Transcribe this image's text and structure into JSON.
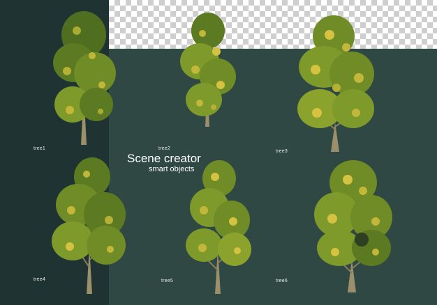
{
  "heading": {
    "title": "Scene creator",
    "subtitle": "smart objects"
  },
  "trees": [
    {
      "label": "tree1"
    },
    {
      "label": "tree2"
    },
    {
      "label": "tree3"
    },
    {
      "label": "tree4"
    },
    {
      "label": "tree5"
    },
    {
      "label": "tree6"
    }
  ],
  "colors": {
    "background": "#2f4843",
    "left_panel": "#1f3432",
    "foliage_dark": "#4f6e1f",
    "foliage_mid": "#7e9a2a",
    "foliage_light": "#c2b73a",
    "trunk": "#9c8f6c",
    "text": "#ffffff"
  }
}
